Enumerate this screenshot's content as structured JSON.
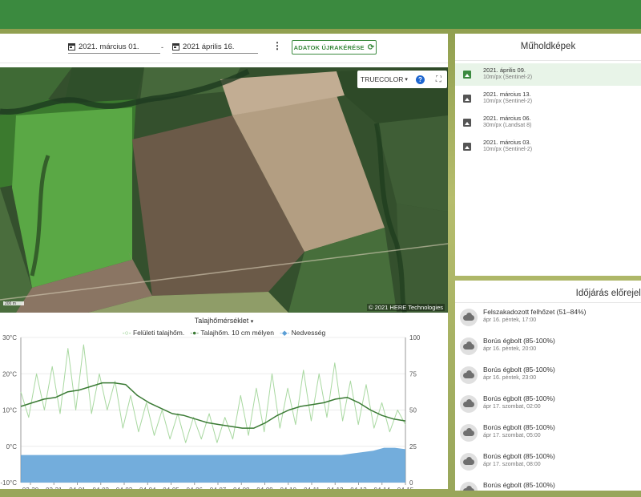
{
  "dates": {
    "start": "2021. március 01.",
    "end": "2021 április 16.",
    "reload_label": "ADATOK ÚJRAKÉRÉSE"
  },
  "map": {
    "layer": "TRUECOLOR",
    "attribution": "© 2021 HERE Technologies",
    "scale_label": "200 m"
  },
  "chart": {
    "title": "Talajhőmérséklet"
  },
  "sat": {
    "title": "Műholdképek",
    "items": [
      {
        "date": "2021. április 09.",
        "res": "10m/px (Sentinel-2)"
      },
      {
        "date": "2021. március 13.",
        "res": "10m/px (Sentinel-2)"
      },
      {
        "date": "2021. március 06.",
        "res": "30m/px (Landsat 8)"
      },
      {
        "date": "2021. március 03.",
        "res": "10m/px (Sentinel-2)"
      }
    ]
  },
  "weather": {
    "title": "Időjárás előrejelzé",
    "items": [
      {
        "desc": "Felszakadozott felhőzet (51–84%)",
        "time": "ápr 16. péntek, 17:00"
      },
      {
        "desc": "Borús égbolt (85-100%)",
        "time": "ápr 16. péntek, 20:00"
      },
      {
        "desc": "Borús égbolt (85-100%)",
        "time": "ápr 16. péntek, 23:00"
      },
      {
        "desc": "Borús égbolt (85-100%)",
        "time": "ápr 17. szombat, 02:00"
      },
      {
        "desc": "Borús égbolt (85-100%)",
        "time": "ápr 17. szombat, 05:00"
      },
      {
        "desc": "Borús égbolt (85-100%)",
        "time": "ápr 17. szombat, 08:00"
      },
      {
        "desc": "Borús égbolt (85-100%)",
        "time": ""
      }
    ]
  },
  "colors": {
    "brand": "#3b8a3f",
    "surface_line": "#a8d8a0",
    "deep_line": "#3a7a34",
    "moisture": "#5b9fd6"
  },
  "chart_data": {
    "type": "line",
    "title": "Talajhőmérséklet",
    "x": [
      "03-30",
      "03-31",
      "04-01",
      "04-02",
      "04-03",
      "04-04",
      "04-05",
      "04-06",
      "04-07",
      "04-08",
      "04-09",
      "04-10",
      "04-11",
      "04-12",
      "04-13",
      "04-14",
      "04-15"
    ],
    "series": [
      {
        "name": "Felületi talajhőm.",
        "axis": "left",
        "values": [
          15,
          8,
          20,
          10,
          22,
          9,
          27,
          10,
          28,
          9,
          20,
          10,
          18,
          5,
          14,
          4,
          12,
          3,
          10,
          2,
          9,
          1,
          8,
          2,
          9,
          1,
          8,
          2,
          14,
          3,
          16,
          4,
          20,
          5,
          16,
          6,
          21,
          7,
          20,
          8,
          23,
          7,
          18,
          6,
          17,
          5,
          12,
          4,
          10,
          6
        ]
      },
      {
        "name": "Talajhőm. 10 cm mélyen",
        "axis": "left",
        "values": [
          11,
          12,
          13,
          13.5,
          15,
          15.5,
          16.5,
          17.5,
          17.5,
          17,
          14,
          12,
          10.5,
          9,
          8.5,
          7.5,
          6.5,
          6,
          5.5,
          5,
          5,
          6.5,
          8.5,
          10,
          11,
          11.5,
          12,
          13,
          13.5,
          12,
          10,
          8.5,
          7.5,
          7
        ]
      },
      {
        "name": "Nedvesség",
        "axis": "right",
        "values": [
          19,
          19,
          19,
          19,
          19,
          19,
          19,
          19,
          19,
          19,
          19,
          19,
          19,
          19,
          19,
          19,
          19,
          19,
          19,
          19,
          19,
          19,
          19,
          19,
          19,
          19,
          19,
          19,
          19,
          19,
          19,
          20,
          21,
          22,
          24,
          24,
          23
        ]
      }
    ],
    "y_left": {
      "ticks": [
        "30°C",
        "20°C",
        "10°C",
        "0°C",
        "-10°C"
      ],
      "range": [
        -10,
        30
      ]
    },
    "y_right": {
      "ticks": [
        "100",
        "75",
        "50",
        "25",
        "0"
      ],
      "range": [
        0,
        100
      ]
    },
    "legend_placement": "top"
  }
}
